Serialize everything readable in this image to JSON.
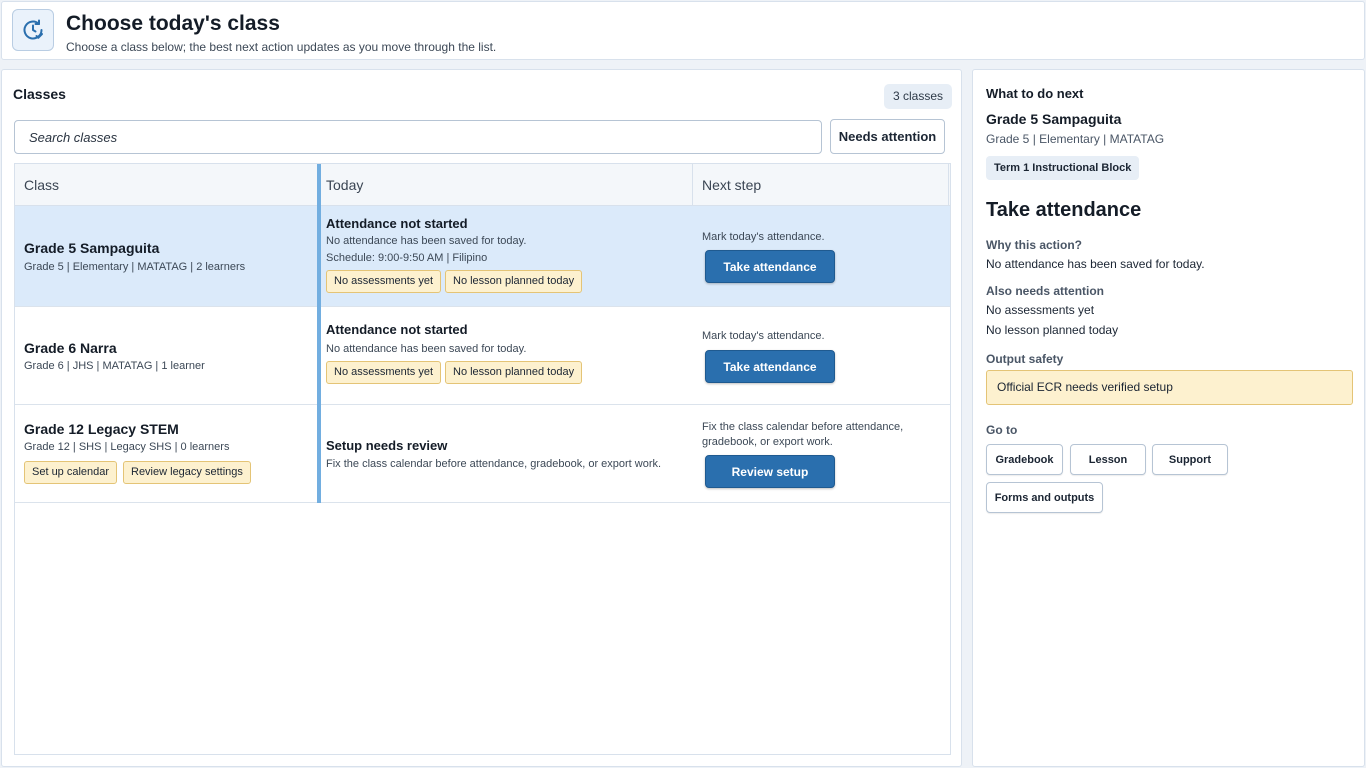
{
  "header": {
    "icon": "clock-check-icon",
    "title": "Choose today's class",
    "subtitle": "Choose a class below; the best next action updates as you move through the list."
  },
  "classes_panel": {
    "title": "Classes",
    "count_label": "3 classes",
    "search_placeholder": "Search classes",
    "filter_label": "Needs attention",
    "columns": [
      "Class",
      "Today",
      "Next step"
    ],
    "rows": [
      {
        "name": "Grade 5 Sampaguita",
        "meta": "Grade 5 | Elementary | MATATAG | 2 learners",
        "class_tags": [],
        "today_title": "Attendance not started",
        "today_sub": "No attendance has been saved for today.",
        "today_schedule": "Schedule: 9:00-9:50 AM | Filipino",
        "today_tags": [
          "No assessments yet",
          "No lesson planned today"
        ],
        "next_text": "Mark today's attendance.",
        "next_button": "Take attendance",
        "selected": true
      },
      {
        "name": "Grade 6 Narra",
        "meta": "Grade 6 | JHS | MATATAG | 1 learner",
        "class_tags": [],
        "today_title": "Attendance not started",
        "today_sub": "No attendance has been saved for today.",
        "today_tags": [
          "No assessments yet",
          "No lesson planned today"
        ],
        "next_text": "Mark today's attendance.",
        "next_button": "Take attendance",
        "selected": false
      },
      {
        "name": "Grade 12 Legacy STEM",
        "meta": "Grade 12 | SHS | Legacy SHS | 0 learners",
        "class_tags": [
          "Set up calendar",
          "Review legacy settings"
        ],
        "today_title": "Setup needs review",
        "today_sub": "Fix the class calendar before attendance, gradebook, or export work.",
        "today_tags": [],
        "next_text": "Fix the class calendar before attendance, gradebook, or export work.",
        "next_button": "Review setup",
        "selected": false
      }
    ]
  },
  "next_panel": {
    "heading": "What to do next",
    "class_name": "Grade 5 Sampaguita",
    "class_meta": "Grade 5 | Elementary | MATATAG",
    "block_chip": "Term 1 Instructional Block",
    "action_title": "Take attendance",
    "why_label": "Why this action?",
    "why_text": "No attendance has been saved for today.",
    "also_label": "Also needs attention",
    "also_items": [
      "No assessments yet",
      "No lesson planned today"
    ],
    "safety_label": "Output safety",
    "safety_text": "Official ECR needs verified setup",
    "goto_label": "Go to",
    "goto_buttons": [
      "Gradebook",
      "Lesson",
      "Support",
      "Forms and outputs"
    ]
  },
  "colors": {
    "primary": "#2a6fae",
    "selected_row": "#dbeafa",
    "warning_bg": "#fdf1cf",
    "warning_border": "#e4c476",
    "accent_bar": "#72aee0"
  }
}
